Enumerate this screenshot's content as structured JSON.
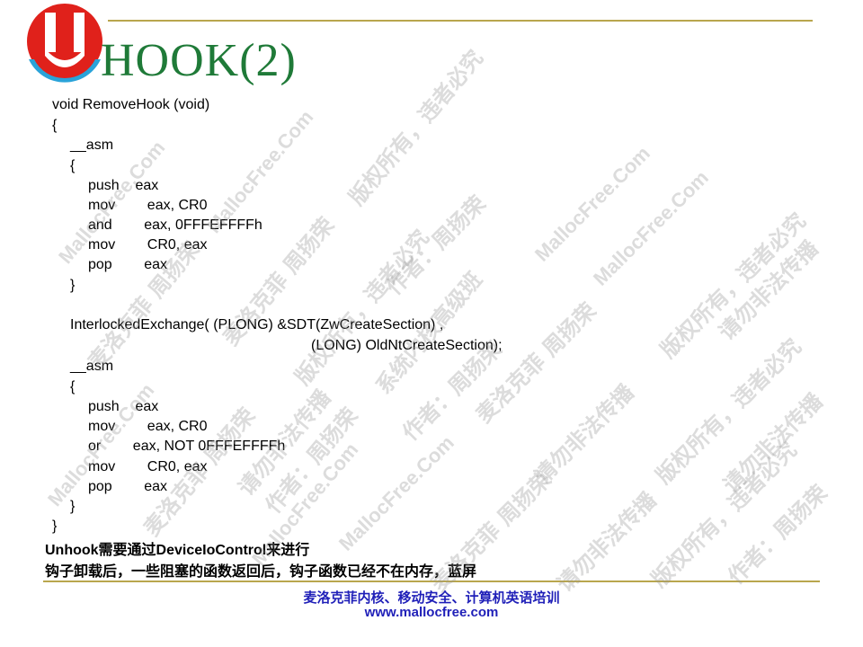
{
  "slide": {
    "title": "HOOK(2)"
  },
  "code_lines": [
    "void RemoveHook (void)",
    "{",
    "__asm",
    "{",
    "push    eax",
    "mov        eax, CR0",
    "and        eax, 0FFFEFFFFh",
    "mov        CR0, eax",
    "pop        eax",
    "}",
    "InterlockedExchange( (PLONG) &SDT(ZwCreateSection) ,",
    "(LONG) OldNtCreateSection);",
    "__asm",
    "{",
    "push    eax",
    "mov        eax, CR0",
    "or        eax, NOT 0FFFEFFFFh",
    "mov        CR0, eax",
    "pop        eax",
    "}",
    "}"
  ],
  "notes": [
    "Unhook需要通过DeviceIoControl来进行",
    "钩子卸载后，一些阻塞的函数返回后，钩子函数已经不在内存，蓝屏"
  ],
  "footer": {
    "line1": "麦洛克菲内核、移动安全、计算机英语培训",
    "line2": "www.mallocfree.com"
  },
  "watermarks": {
    "en": "MallocFree.Com",
    "cn_1": "麦洛克菲 周扬荣",
    "cn_2": "版权所有，违者必究",
    "cn_3": "请勿非法传播",
    "cn_4": "作者：周扬荣",
    "cn_5": "系统内核高级班",
    "color": "#969696"
  },
  "colors": {
    "title": "#1f7a38",
    "rule": "#b9a64d",
    "footer": "#1f1fb8",
    "logo_red": "#e0211b",
    "logo_blue": "#2aa3d9"
  }
}
